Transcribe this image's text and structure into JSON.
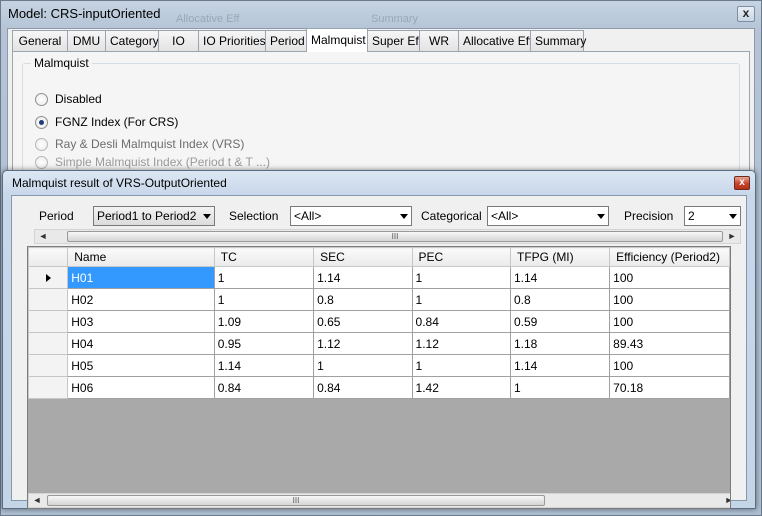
{
  "main_window": {
    "title": "Model: CRS-inputOriented",
    "close_label": "x",
    "ghost_text": [
      "Allocative Eff",
      "Summary"
    ],
    "tabs": [
      {
        "label": "General",
        "active": false
      },
      {
        "label": "DMU",
        "active": false
      },
      {
        "label": "Category",
        "active": false
      },
      {
        "label": "IO",
        "active": false
      },
      {
        "label": "IO Priorities",
        "active": false
      },
      {
        "label": "Period",
        "active": false
      },
      {
        "label": "Malmquist",
        "active": true
      },
      {
        "label": "Super Eff",
        "active": false
      },
      {
        "label": "WR",
        "active": false
      },
      {
        "label": "Allocative Eff",
        "active": false
      },
      {
        "label": "Summary",
        "active": false
      }
    ],
    "group_title": "Malmquist",
    "radios": [
      {
        "label": "Disabled",
        "checked": false,
        "enabled": true
      },
      {
        "label": "FGNZ Index (For CRS)",
        "checked": true,
        "enabled": true
      },
      {
        "label": "Ray & Desli Malmquist Index (VRS)",
        "checked": false,
        "enabled": false
      }
    ],
    "partial_text": "Simple Malmquist Index (Period t & T ...)"
  },
  "dialog": {
    "title": "Malmquist result of VRS-OutputOriented",
    "close_label": "x",
    "filters": {
      "period_label": "Period",
      "period_value": "Period1 to Period2",
      "selection_label": "Selection",
      "selection_value": "<All>",
      "categorical_label": "Categorical",
      "categorical_value": "<All>",
      "precision_label": "Precision",
      "precision_value": "2"
    },
    "scroll_thumb_glyph": "III",
    "scroll_left_glyph": "◄",
    "scroll_right_glyph": "►",
    "grid": {
      "columns": [
        "Name",
        "TC",
        "SEC",
        "PEC",
        "TFPG (MI)",
        "Efficiency (Period2)"
      ],
      "rows": [
        [
          "H01",
          "1",
          "1.14",
          "1",
          "1.14",
          "100"
        ],
        [
          "H02",
          "1",
          "0.8",
          "1",
          "0.8",
          "100"
        ],
        [
          "H03",
          "1.09",
          "0.65",
          "0.84",
          "0.59",
          "100"
        ],
        [
          "H04",
          "0.95",
          "1.12",
          "1.12",
          "1.18",
          "89.43"
        ],
        [
          "H05",
          "1.14",
          "1",
          "1",
          "1.14",
          "100"
        ],
        [
          "H06",
          "0.84",
          "0.84",
          "1.42",
          "1",
          "70.18"
        ]
      ],
      "selected_row": 0
    }
  }
}
